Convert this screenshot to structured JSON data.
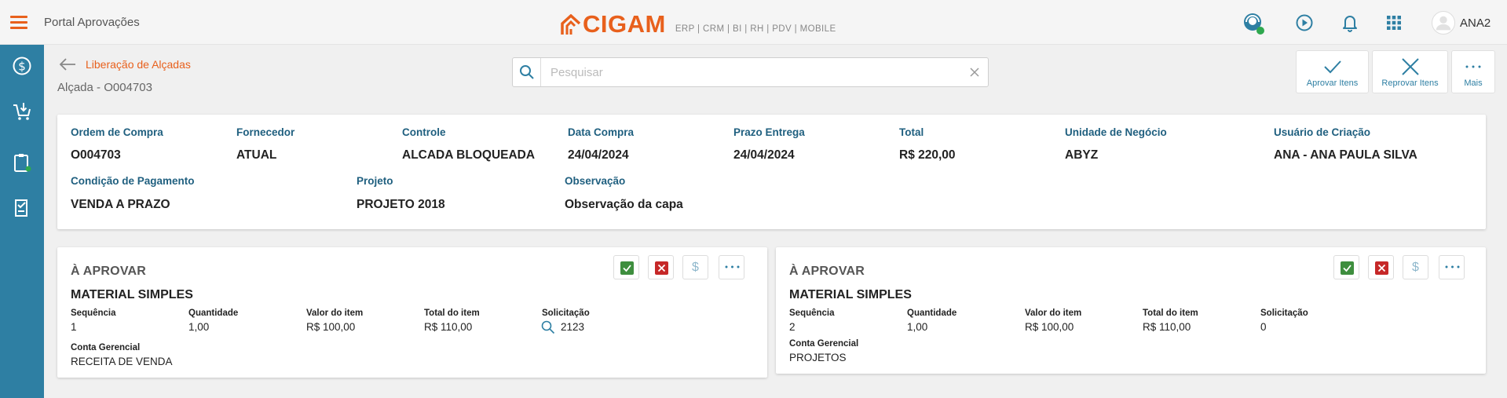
{
  "header": {
    "portal_title": "Portal Aprovações",
    "logo_text": "CIGAM",
    "logo_sub": "ERP | CRM | BI | RH | PDV | MOBILE",
    "user_name": "ANA2"
  },
  "breadcrumb": {
    "link": "Liberação de Alçadas",
    "title": "Alçada - O004703"
  },
  "search": {
    "placeholder": "Pesquisar",
    "value": ""
  },
  "actions": {
    "approve": "Aprovar Itens",
    "reject": "Reprovar Itens",
    "more": "Mais"
  },
  "summary": {
    "row1": [
      {
        "label": "Ordem de Compra",
        "value": "O004703"
      },
      {
        "label": "Fornecedor",
        "value": "ATUAL"
      },
      {
        "label": "Controle",
        "value": "ALCADA BLOQUEADA"
      },
      {
        "label": "Data Compra",
        "value": "24/04/2024"
      },
      {
        "label": "Prazo Entrega",
        "value": "24/04/2024"
      },
      {
        "label": "Total",
        "value": "R$ 220,00"
      },
      {
        "label": "Unidade de Negócio",
        "value": "ABYZ"
      },
      {
        "label": "Usuário de Criação",
        "value": "ANA - ANA PAULA SILVA"
      }
    ],
    "row2": [
      {
        "label": "Condição de Pagamento",
        "value": "VENDA A PRAZO"
      },
      {
        "label": "Projeto",
        "value": "PROJETO 2018"
      },
      {
        "label": "Observação",
        "value": "Observação da capa"
      }
    ]
  },
  "items": [
    {
      "status": "À APROVAR",
      "name": "MATERIAL SIMPLES",
      "labels": {
        "seq": "Sequência",
        "qty": "Quantidade",
        "unit": "Valor do item",
        "total": "Total do item",
        "req": "Solicitação",
        "account": "Conta Gerencial"
      },
      "seq": "1",
      "qty": "1,00",
      "unit": "R$ 100,00",
      "total": "R$ 110,00",
      "req": "2123",
      "account": "RECEITA DE VENDA"
    },
    {
      "status": "À APROVAR",
      "name": "MATERIAL SIMPLES",
      "labels": {
        "seq": "Sequência",
        "qty": "Quantidade",
        "unit": "Valor do item",
        "total": "Total do item",
        "req": "Solicitação",
        "account": "Conta Gerencial"
      },
      "seq": "2",
      "qty": "1,00",
      "unit": "R$ 100,00",
      "total": "R$ 110,00",
      "req": "0",
      "account": "PROJETOS"
    }
  ],
  "icons": {
    "dollar": "$"
  },
  "colors": {
    "brand_orange": "#e8601c",
    "sidebar_blue": "#2e7fa3",
    "label_blue": "#1f5f7f",
    "approve_green": "#3e8e3e",
    "reject_red": "#c62828"
  }
}
